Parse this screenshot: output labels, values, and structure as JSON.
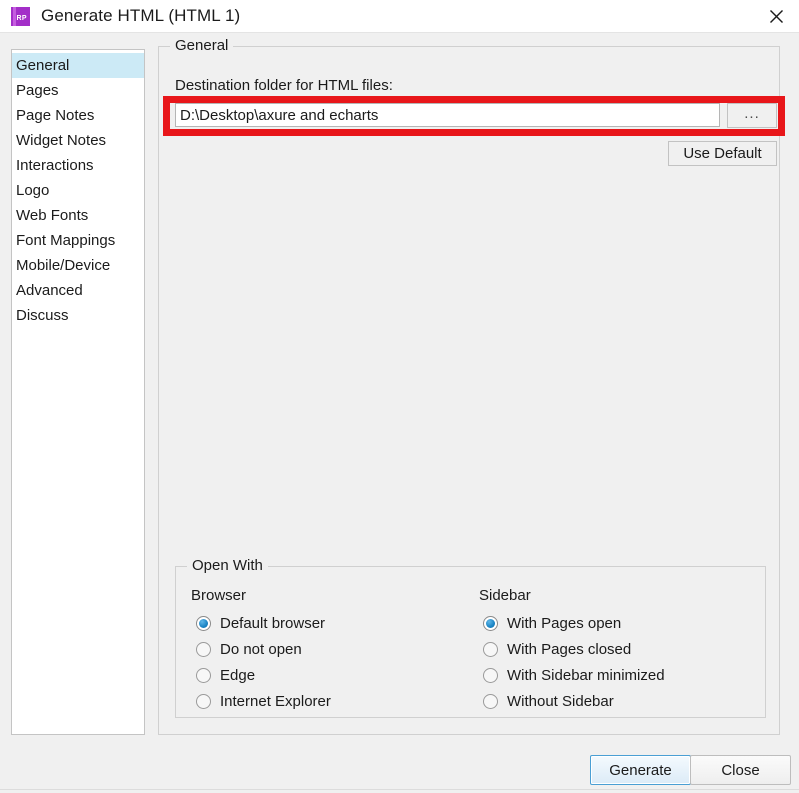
{
  "window": {
    "title": "Generate HTML (HTML 1)",
    "app_icon_text": "RP",
    "app_icon_color": "#a32fc8",
    "close_icon": "close-icon"
  },
  "sidebar": {
    "selected": "General",
    "highlight_color": "#cceaf6",
    "items": [
      {
        "label": "General"
      },
      {
        "label": "Pages"
      },
      {
        "label": "Page Notes"
      },
      {
        "label": "Widget Notes"
      },
      {
        "label": "Interactions"
      },
      {
        "label": "Logo"
      },
      {
        "label": "Web Fonts"
      },
      {
        "label": "Font Mappings"
      },
      {
        "label": "Mobile/Device"
      },
      {
        "label": "Advanced"
      },
      {
        "label": "Discuss"
      }
    ]
  },
  "general_group": {
    "legend": "General",
    "destination": {
      "label": "Destination folder for HTML files:",
      "value": "D:\\Desktop\\axure and echarts",
      "placeholder": "",
      "browse_label": "...",
      "use_default_label": "Use Default"
    },
    "highlight": {
      "name": "destination-highlight",
      "color": "#e8161a"
    }
  },
  "open_with": {
    "legend": "Open With",
    "browser": {
      "heading": "Browser",
      "selected": "Default browser",
      "options": [
        {
          "label": "Default browser",
          "checked": true
        },
        {
          "label": "Do not open",
          "checked": false
        },
        {
          "label": "Edge",
          "checked": false
        },
        {
          "label": "Internet Explorer",
          "checked": false
        }
      ]
    },
    "sidebar": {
      "heading": "Sidebar",
      "selected": "With Pages open",
      "options": [
        {
          "label": "With Pages open",
          "checked": true
        },
        {
          "label": "With Pages closed",
          "checked": false
        },
        {
          "label": "With Sidebar minimized",
          "checked": false
        },
        {
          "label": "Without Sidebar",
          "checked": false
        }
      ]
    }
  },
  "footer": {
    "generate_label": "Generate",
    "close_label": "Close"
  }
}
